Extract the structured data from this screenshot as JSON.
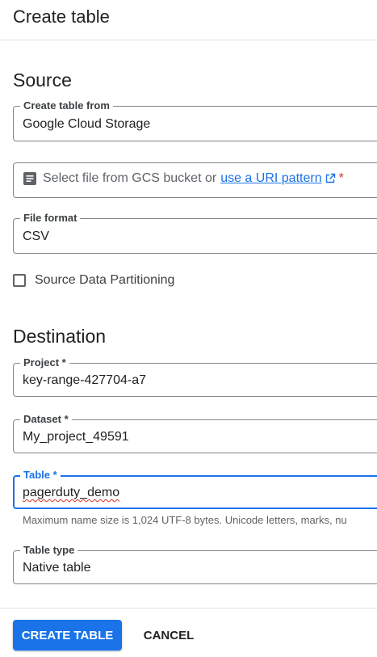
{
  "header": {
    "title": "Create table"
  },
  "source": {
    "title": "Source",
    "create_from": {
      "label": "Create table from",
      "value": "Google Cloud Storage"
    },
    "gcs_file": {
      "placeholder": "Select file from GCS bucket or",
      "link_text": "use a URI pattern",
      "required_marker": "*"
    },
    "file_format": {
      "label": "File format",
      "value": "CSV"
    },
    "partitioning": {
      "label": "Source Data Partitioning",
      "checked": false
    }
  },
  "destination": {
    "title": "Destination",
    "project": {
      "label": "Project *",
      "value": "key-range-427704-a7"
    },
    "dataset": {
      "label": "Dataset *",
      "value": "My_project_49591"
    },
    "table": {
      "label": "Table *",
      "value": "pagerduty_demo",
      "hint": "Maximum name size is 1,024 UTF-8 bytes. Unicode letters, marks, nu"
    },
    "table_type": {
      "label": "Table type",
      "value": "Native table"
    }
  },
  "footer": {
    "create_label": "CREATE TABLE",
    "cancel_label": "CANCEL"
  },
  "colors": {
    "accent": "#1a73e8",
    "error": "#d93025",
    "border": "#80868b"
  }
}
